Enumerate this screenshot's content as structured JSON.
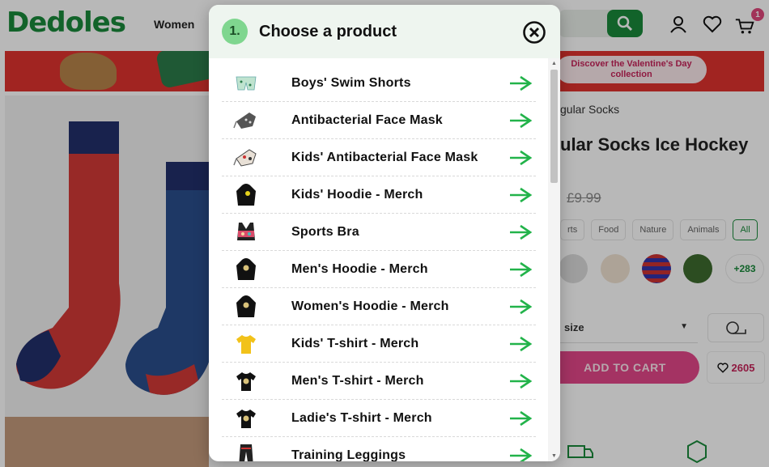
{
  "site": {
    "logo": "Dedoles",
    "nav_women": "Women",
    "cart_count": "1"
  },
  "banner": {
    "cta": "Discover the Valentine's Day collection"
  },
  "product": {
    "breadcrumb": "gular Socks",
    "title": "ular Socks Ice Hockey",
    "old_price": "£9.99",
    "categories": [
      "rts",
      "Food",
      "Nature",
      "Animals",
      "All"
    ],
    "more_variants": "+283",
    "size_label": "size",
    "add_to_cart": "ADD TO CART",
    "wishlist_count": "2605"
  },
  "modal": {
    "step": "1.",
    "title": "Choose a product",
    "items": [
      {
        "label": "Boys' Swim Shorts",
        "icon": "swim-shorts-icon"
      },
      {
        "label": "Antibacterial Face Mask",
        "icon": "face-mask-icon"
      },
      {
        "label": "Kids' Antibacterial Face Mask",
        "icon": "kids-face-mask-icon"
      },
      {
        "label": "Kids' Hoodie - Merch",
        "icon": "hoodie-icon"
      },
      {
        "label": "Sports Bra",
        "icon": "sports-bra-icon"
      },
      {
        "label": "Men's Hoodie - Merch",
        "icon": "hoodie-icon"
      },
      {
        "label": "Women's Hoodie - Merch",
        "icon": "hoodie-icon"
      },
      {
        "label": "Kids' T-shirt - Merch",
        "icon": "tshirt-icon"
      },
      {
        "label": "Men's T-shirt - Merch",
        "icon": "tshirt-icon"
      },
      {
        "label": "Ladie's T-shirt - Merch",
        "icon": "tshirt-icon"
      },
      {
        "label": "Training Leggings",
        "icon": "leggings-icon"
      }
    ]
  },
  "colors": {
    "brand_green": "#1a8a3b",
    "arrow_green": "#22b34a",
    "pink": "#e3478a",
    "header_bg": "#eef5ef"
  }
}
